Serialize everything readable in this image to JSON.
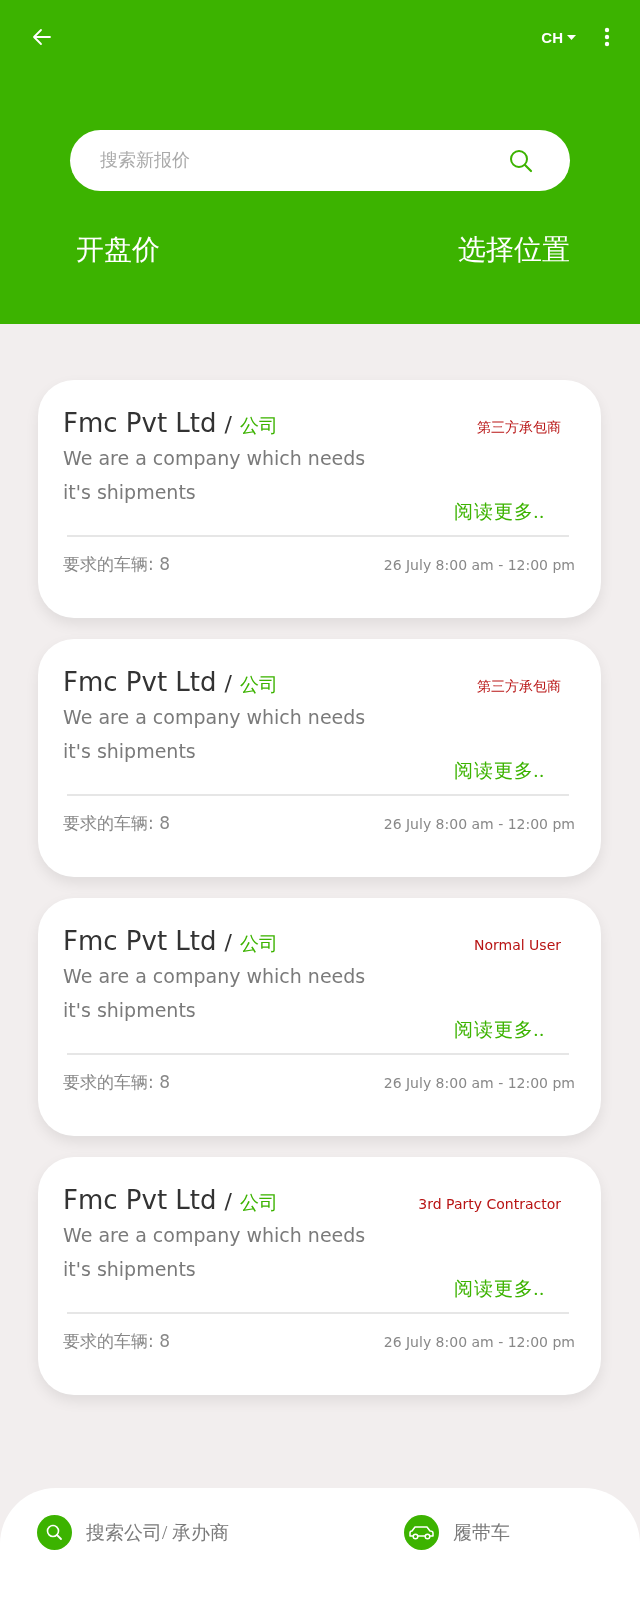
{
  "header": {
    "language": "CH",
    "search": {
      "placeholder": "搜索新报价"
    },
    "links": [
      "开盘价",
      "选择位置"
    ]
  },
  "cards": [
    {
      "company": "Fmc Pvt Ltd",
      "separator": "/",
      "type": "公司",
      "tag": "第三方承包商",
      "description": "We are a company which needs it's shipments",
      "read_more": "阅读更多..",
      "vehicles": "要求的车辆: 8",
      "time": "26 July 8:00 am - 12:00 pm"
    },
    {
      "company": "Fmc Pvt Ltd",
      "separator": "/",
      "type": "公司",
      "tag": "第三方承包商",
      "description": "We are a company which needs it's shipments",
      "read_more": "阅读更多..",
      "vehicles": "要求的车辆: 8",
      "time": "26 July 8:00 am - 12:00 pm"
    },
    {
      "company": "Fmc Pvt Ltd",
      "separator": "/",
      "type": "公司",
      "tag": "Normal User",
      "description": "We are a company which needs it's shipments",
      "read_more": "阅读更多..",
      "vehicles": "要求的车辆: 8",
      "time": "26 July 8:00 am - 12:00 pm"
    },
    {
      "company": "Fmc Pvt Ltd",
      "separator": "/",
      "type": "公司",
      "tag": "3rd Party Contractor",
      "description": "We are a company which needs it's shipments",
      "read_more": "阅读更多..",
      "vehicles": "要求的车辆: 8",
      "time": "26 July 8:00 am - 12:00 pm"
    }
  ],
  "bottom_bar": [
    {
      "kind": "search",
      "label": "搜索公司/ 承办商"
    },
    {
      "kind": "car",
      "label": "履带车"
    }
  ]
}
